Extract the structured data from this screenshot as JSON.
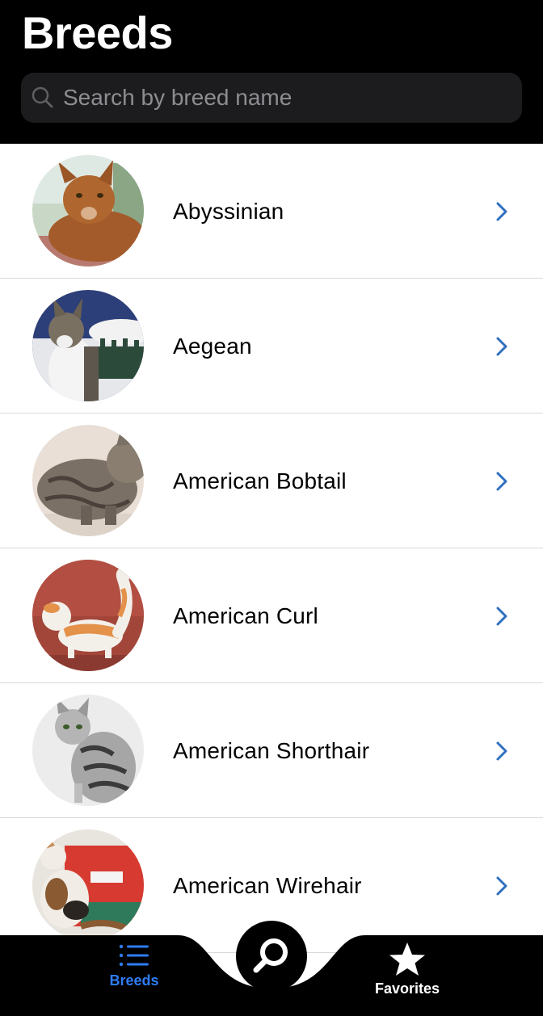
{
  "header": {
    "title": "Breeds",
    "search_placeholder": "Search by breed name"
  },
  "breeds": [
    {
      "name": "Abyssinian"
    },
    {
      "name": "Aegean"
    },
    {
      "name": "American Bobtail"
    },
    {
      "name": "American Curl"
    },
    {
      "name": "American Shorthair"
    },
    {
      "name": "American Wirehair"
    }
  ],
  "tabbar": {
    "tabs": [
      {
        "label": "Breeds",
        "icon": "list-icon",
        "active": true
      },
      {
        "label": "Favorites",
        "icon": "star-icon",
        "active": false
      }
    ],
    "center_button_icon": "search-icon"
  },
  "colors": {
    "accent": "#2f7cf6",
    "header_bg": "#000000",
    "search_bg": "#1c1c1e",
    "chevron": "#2f6fbf"
  }
}
